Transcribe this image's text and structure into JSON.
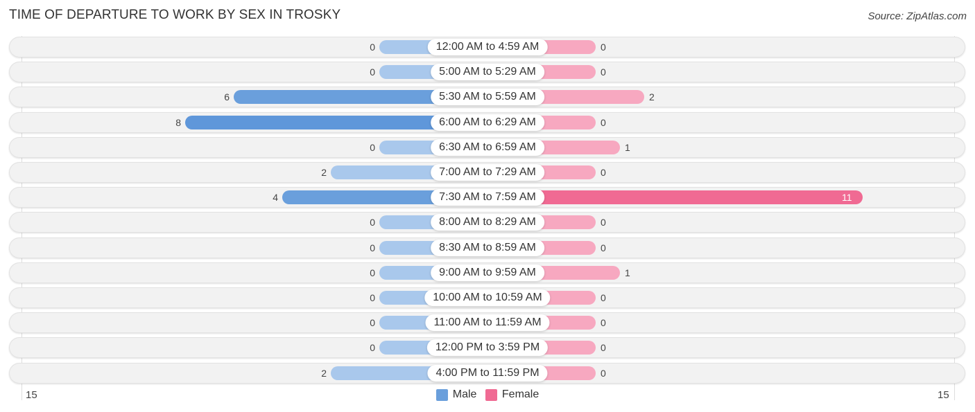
{
  "chart_data": {
    "type": "bar",
    "orientation": "horizontal-diverging",
    "title": "TIME OF DEPARTURE TO WORK BY SEX IN TROSKY",
    "source": "Source: ZipAtlas.com",
    "categories": [
      "12:00 AM to 4:59 AM",
      "5:00 AM to 5:29 AM",
      "5:30 AM to 5:59 AM",
      "6:00 AM to 6:29 AM",
      "6:30 AM to 6:59 AM",
      "7:00 AM to 7:29 AM",
      "7:30 AM to 7:59 AM",
      "8:00 AM to 8:29 AM",
      "8:30 AM to 8:59 AM",
      "9:00 AM to 9:59 AM",
      "10:00 AM to 10:59 AM",
      "11:00 AM to 11:59 AM",
      "12:00 PM to 3:59 PM",
      "4:00 PM to 11:59 PM"
    ],
    "series": [
      {
        "name": "Male",
        "color": "#6a9fdc",
        "values": [
          0,
          0,
          6,
          8,
          0,
          2,
          4,
          0,
          0,
          0,
          0,
          0,
          0,
          2
        ]
      },
      {
        "name": "Female",
        "color": "#f06a93",
        "values": [
          0,
          0,
          2,
          0,
          1,
          0,
          11,
          0,
          0,
          1,
          0,
          0,
          0,
          0
        ]
      }
    ],
    "axis": {
      "left_tick": "15",
      "right_tick": "15",
      "range": [
        15,
        15
      ]
    },
    "legend": {
      "position": "bottom-center",
      "items": [
        "Male",
        "Female"
      ]
    }
  }
}
